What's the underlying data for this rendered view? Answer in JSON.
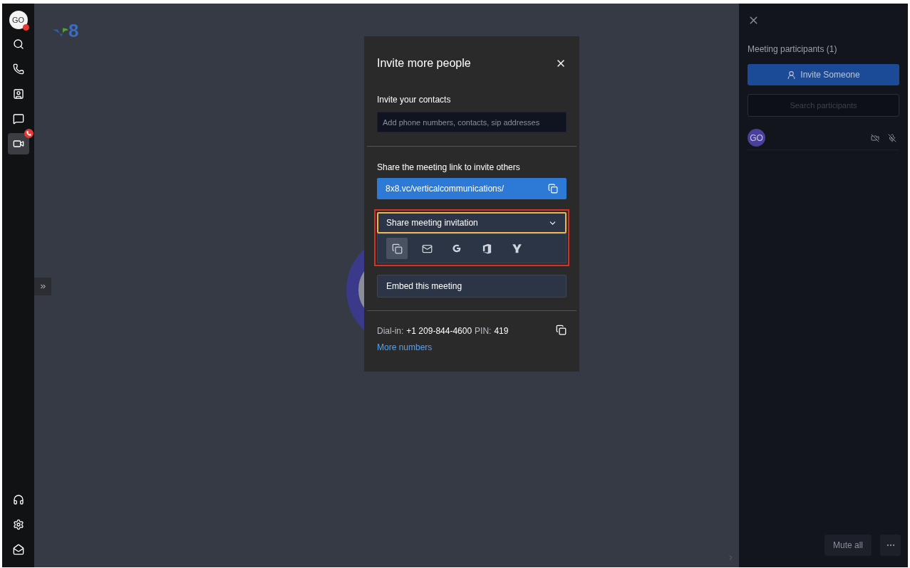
{
  "sidebar": {
    "avatar": {
      "initials": "GO"
    },
    "items": [
      {
        "kind": "search",
        "selected": false,
        "badge": false
      },
      {
        "kind": "phone",
        "selected": false,
        "badge": false
      },
      {
        "kind": "contacts",
        "selected": false,
        "badge": false
      },
      {
        "kind": "chat",
        "selected": false,
        "badge": false
      },
      {
        "kind": "video",
        "selected": true,
        "badge": true
      }
    ],
    "bottom_items": [
      {
        "kind": "support"
      },
      {
        "kind": "settings"
      },
      {
        "kind": "inbox"
      }
    ]
  },
  "logo": {
    "text": "8"
  },
  "dialog": {
    "title": "Invite more people",
    "contacts_label": "Invite your contacts",
    "contacts_placeholder": "Add phone numbers, contacts, sip addresses",
    "link_label": "Share the meeting link to invite others",
    "link": "8x8.vc/verticalcommunications/",
    "share_dropdown": {
      "label": "Share meeting invitation",
      "expanded": true,
      "options": [
        {
          "kind": "copy",
          "selected": true
        },
        {
          "kind": "email",
          "selected": false
        },
        {
          "kind": "google",
          "selected": false
        },
        {
          "kind": "office",
          "selected": false
        },
        {
          "kind": "yahoo",
          "selected": false
        }
      ]
    },
    "embed_button": "Embed this meeting",
    "dial_in_label": "Dial-in:",
    "dial_in_number": "+1 209-844-4600",
    "pin_label": "PIN:",
    "pin": "419",
    "more_numbers": "More numbers"
  },
  "participants_panel": {
    "title": "Meeting participants (1)",
    "invite_button": "Invite Someone",
    "search_placeholder": "Search participants",
    "participants": [
      {
        "initials": "GO",
        "video_off": true,
        "muted": true
      }
    ],
    "mute_all_button": "Mute all"
  }
}
